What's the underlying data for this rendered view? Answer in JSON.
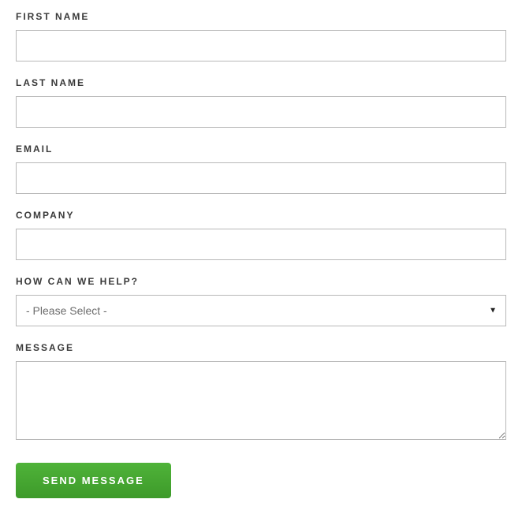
{
  "form": {
    "first_name": {
      "label": "FIRST NAME",
      "value": ""
    },
    "last_name": {
      "label": "LAST NAME",
      "value": ""
    },
    "email": {
      "label": "EMAIL",
      "value": ""
    },
    "company": {
      "label": "COMPANY",
      "value": ""
    },
    "help": {
      "label": "HOW CAN WE HELP?",
      "selected": "- Please Select -"
    },
    "message": {
      "label": "MESSAGE",
      "value": ""
    },
    "submit_label": "SEND MESSAGE"
  }
}
